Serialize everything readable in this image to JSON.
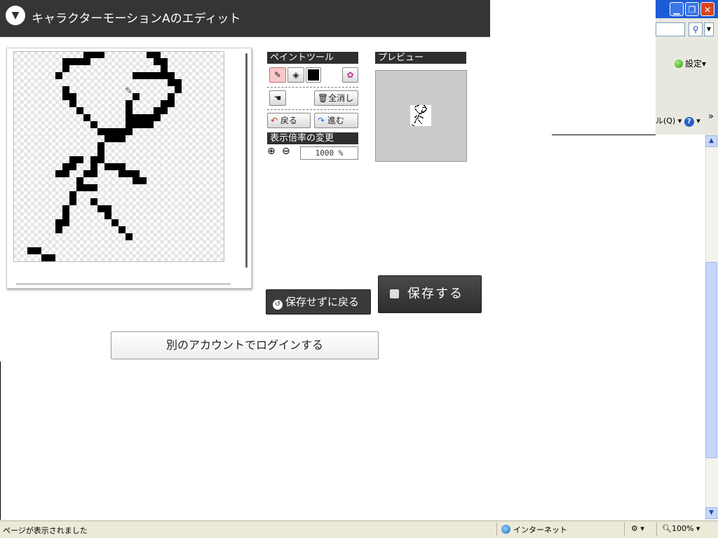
{
  "header": {
    "title": "キャラクターモーションAのエディット",
    "toggle_icon": "▼"
  },
  "browser": {
    "settings_label": "設定",
    "toolbar_fragment": "ル(Q)",
    "help_icon": "?",
    "chevron": "»",
    "status_text": "ページが表示されました",
    "zone_label": "インターネット",
    "zoom_label": "100%"
  },
  "tools": {
    "paint_title": "ペイントツール",
    "clear_all_label": "全消し",
    "undo_label": "戻る",
    "redo_label": "進む",
    "zoom_title": "表示倍率の変更",
    "zoom_value": "1000 %",
    "current_color": "#000000"
  },
  "preview": {
    "title": "プレビュー"
  },
  "actions": {
    "back_without_save": "保存せずに戻る",
    "save": "保存する",
    "login_other": "別のアカウントでログインする"
  },
  "canvas": {
    "grid_size": 30,
    "filled_cells": [
      [
        10,
        0
      ],
      [
        11,
        0
      ],
      [
        12,
        0
      ],
      [
        19,
        0
      ],
      [
        20,
        0
      ],
      [
        7,
        1
      ],
      [
        8,
        1
      ],
      [
        9,
        1
      ],
      [
        10,
        1
      ],
      [
        20,
        1
      ],
      [
        21,
        1
      ],
      [
        7,
        2
      ],
      [
        21,
        2
      ],
      [
        6,
        3
      ],
      [
        17,
        3
      ],
      [
        18,
        3
      ],
      [
        19,
        3
      ],
      [
        20,
        3
      ],
      [
        21,
        3
      ],
      [
        22,
        3
      ],
      [
        22,
        4
      ],
      [
        23,
        4
      ],
      [
        7,
        5
      ],
      [
        23,
        5
      ],
      [
        7,
        6
      ],
      [
        8,
        6
      ],
      [
        17,
        6
      ],
      [
        22,
        6
      ],
      [
        8,
        7
      ],
      [
        16,
        7
      ],
      [
        21,
        7
      ],
      [
        22,
        7
      ],
      [
        9,
        8
      ],
      [
        16,
        8
      ],
      [
        20,
        8
      ],
      [
        21,
        8
      ],
      [
        10,
        9
      ],
      [
        16,
        9
      ],
      [
        17,
        9
      ],
      [
        18,
        9
      ],
      [
        19,
        9
      ],
      [
        20,
        9
      ],
      [
        11,
        10
      ],
      [
        16,
        10
      ],
      [
        17,
        10
      ],
      [
        18,
        10
      ],
      [
        19,
        10
      ],
      [
        12,
        11
      ],
      [
        13,
        11
      ],
      [
        14,
        11
      ],
      [
        15,
        11
      ],
      [
        16,
        11
      ],
      [
        13,
        12
      ],
      [
        14,
        12
      ],
      [
        15,
        12
      ],
      [
        12,
        13
      ],
      [
        12,
        14
      ],
      [
        8,
        15
      ],
      [
        9,
        15
      ],
      [
        11,
        15
      ],
      [
        12,
        15
      ],
      [
        7,
        16
      ],
      [
        8,
        16
      ],
      [
        11,
        16
      ],
      [
        13,
        16
      ],
      [
        14,
        16
      ],
      [
        15,
        16
      ],
      [
        6,
        17
      ],
      [
        7,
        17
      ],
      [
        10,
        17
      ],
      [
        11,
        17
      ],
      [
        15,
        17
      ],
      [
        16,
        17
      ],
      [
        17,
        17
      ],
      [
        9,
        18
      ],
      [
        17,
        18
      ],
      [
        18,
        18
      ],
      [
        9,
        19
      ],
      [
        10,
        19
      ],
      [
        11,
        19
      ],
      [
        8,
        20
      ],
      [
        8,
        21
      ],
      [
        11,
        21
      ],
      [
        7,
        22
      ],
      [
        12,
        22
      ],
      [
        13,
        22
      ],
      [
        7,
        23
      ],
      [
        13,
        23
      ],
      [
        6,
        24
      ],
      [
        7,
        24
      ],
      [
        14,
        24
      ],
      [
        6,
        25
      ],
      [
        15,
        25
      ],
      [
        16,
        26
      ],
      [
        2,
        28
      ],
      [
        3,
        28
      ],
      [
        4,
        29
      ],
      [
        5,
        29
      ]
    ]
  }
}
